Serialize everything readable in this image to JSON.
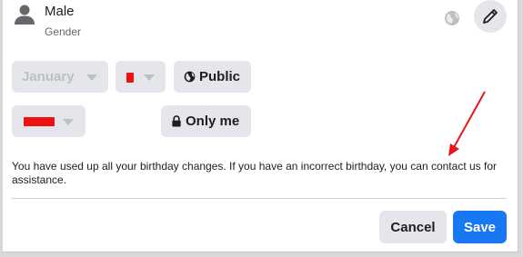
{
  "gender": {
    "value": "Male",
    "label": "Gender",
    "icon": "person-icon",
    "audience_icon": "globe-icon",
    "edit_icon": "pencil-icon"
  },
  "birthday": {
    "month_value": "January",
    "day_value": "",
    "year_value": "",
    "redaction_color": "#ee1111"
  },
  "audience": {
    "date_label": "Public",
    "date_icon": "globe-icon",
    "year_label": "Only me",
    "year_icon": "lock-icon"
  },
  "info_text": "You have used up all your birthday changes. If you have an incorrect birthday, you can contact us for assistance.",
  "footer": {
    "cancel_label": "Cancel",
    "save_label": "Save"
  },
  "colors": {
    "primary": "#1877f2",
    "button_gray": "#e4e6eb",
    "annotation_red": "#e8151a"
  }
}
